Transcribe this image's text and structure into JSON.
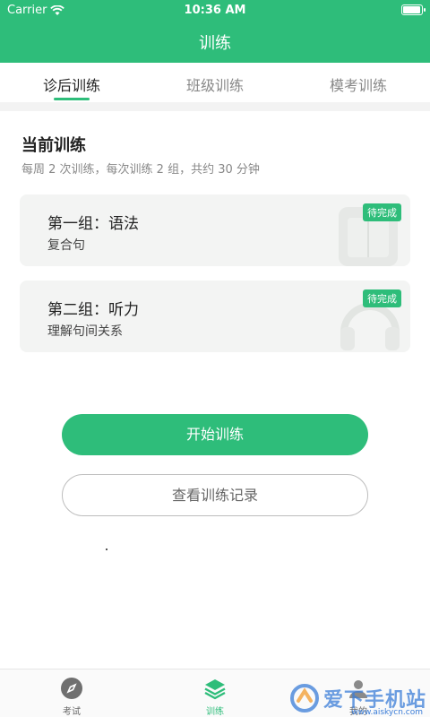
{
  "status_bar": {
    "carrier": "Carrier",
    "time": "10:36 AM",
    "battery_level": 1.0
  },
  "nav": {
    "title": "训练"
  },
  "tabs": [
    {
      "label": "诊后训练",
      "active": true
    },
    {
      "label": "班级训练",
      "active": false
    },
    {
      "label": "模考训练",
      "active": false
    }
  ],
  "current": {
    "title": "当前训练",
    "description": "每周 2 次训练，每次训练 2 组，共约 30 分钟"
  },
  "cards": [
    {
      "title": "第一组：语法",
      "subtitle": "复合句",
      "badge": "待完成",
      "icon": "book-icon"
    },
    {
      "title": "第二组：听力",
      "subtitle": "理解句间关系",
      "badge": "待完成",
      "icon": "headphones-icon"
    }
  ],
  "buttons": {
    "start": "开始训练",
    "history": "查看训练记录"
  },
  "bottom_nav": [
    {
      "label": "考试",
      "icon": "compass-icon",
      "active": false
    },
    {
      "label": "训练",
      "icon": "layers-icon",
      "active": true
    },
    {
      "label": "我的",
      "icon": "user-icon",
      "active": false
    }
  ],
  "watermark": {
    "text": "爱下手机站",
    "url": "www.aiskycn.com"
  },
  "colors": {
    "brand": "#2ebd7a",
    "background": "#ffffff",
    "card": "#f3f4f3",
    "watermark": "#3b7dd8"
  }
}
